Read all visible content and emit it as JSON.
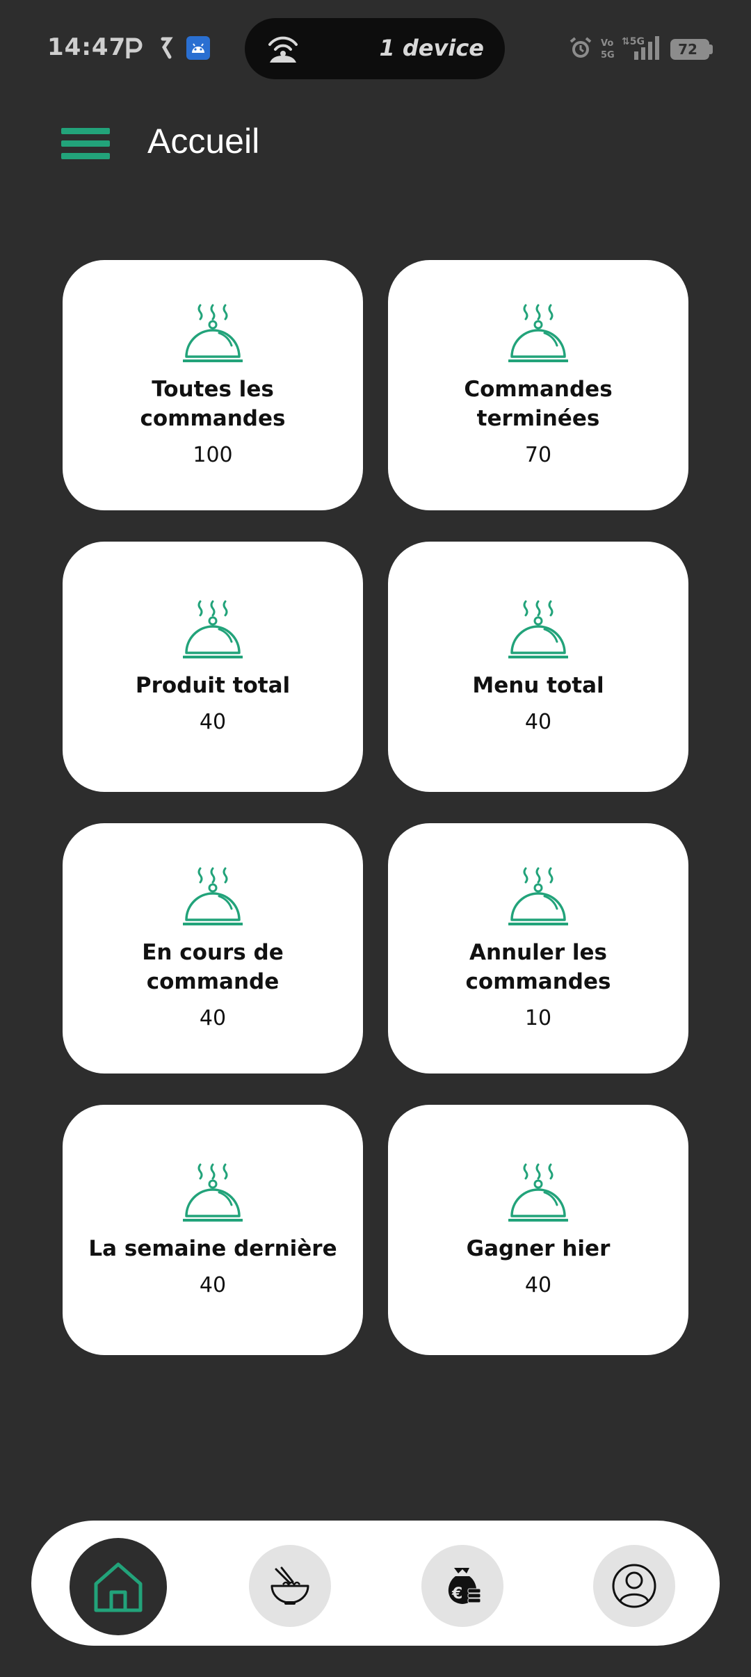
{
  "status_bar": {
    "time": "14:47",
    "island_text": "1 device",
    "battery_level": "72"
  },
  "header": {
    "title": "Accueil"
  },
  "cards": [
    {
      "label": "Toutes les commandes",
      "value": "100"
    },
    {
      "label": "Commandes terminées",
      "value": "70"
    },
    {
      "label": "Produit total",
      "value": "40"
    },
    {
      "label": "Menu total",
      "value": "40"
    },
    {
      "label": "En cours de commande",
      "value": "40"
    },
    {
      "label": "Annuler les commandes",
      "value": "10"
    },
    {
      "label": "La semaine dernière",
      "value": "40"
    },
    {
      "label": "Gagner hier",
      "value": "40"
    }
  ],
  "bottom_nav": {
    "items": [
      {
        "icon": "home-icon",
        "active": true
      },
      {
        "icon": "noodle-bowl-icon",
        "active": false
      },
      {
        "icon": "money-bag-euro-icon",
        "active": false
      },
      {
        "icon": "user-profile-icon",
        "active": false
      }
    ]
  },
  "colors": {
    "background": "#2d2d2d",
    "accent": "#22a37a",
    "card": "#ffffff"
  }
}
